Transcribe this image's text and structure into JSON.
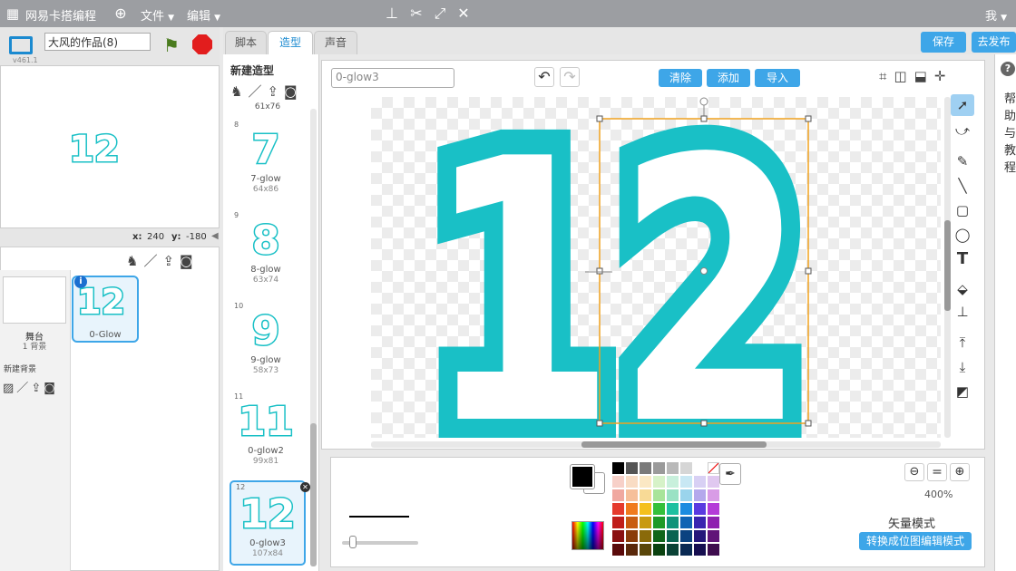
{
  "app": {
    "title": "网易卡搭编程",
    "menu_file": "文件",
    "menu_edit": "编辑",
    "user": "我"
  },
  "stage": {
    "project_name": "大风的作品(8)",
    "version": "v461.1",
    "display_text": "12",
    "x_label": "x:",
    "x_value": "240",
    "y_label": "y:",
    "y_value": "-180"
  },
  "sprites_panel": {
    "stage_label": "舞台",
    "backdrop_count": "1 背景",
    "new_backdrop": "新建背景",
    "sprite_name": "0-Glow",
    "sprite_text": "12"
  },
  "tabs": [
    {
      "label": "脚本"
    },
    {
      "label": "造型"
    },
    {
      "label": "声音"
    }
  ],
  "actions": {
    "save": "保存",
    "publish": "去发布"
  },
  "costumes": {
    "new_costume": "新建造型",
    "cut_top": "61x76",
    "items": [
      {
        "index": "8",
        "glyph": "7",
        "name": "7-glow",
        "size": "64x86"
      },
      {
        "index": "9",
        "glyph": "8",
        "name": "8-glow",
        "size": "63x74"
      },
      {
        "index": "10",
        "glyph": "9",
        "name": "9-glow",
        "size": "58x73"
      },
      {
        "index": "11",
        "glyph": "11",
        "name": "0-glow2",
        "size": "99x81"
      },
      {
        "index": "12",
        "glyph": "12",
        "name": "0-glow3",
        "size": "107x84"
      }
    ]
  },
  "editor": {
    "costume_name": "0-glow3",
    "clear": "清除",
    "add": "添加",
    "import": "导入",
    "canvas_text": "12",
    "zoom": "400%",
    "vector_mode": "矢量模式",
    "convert_bitmap": "转换成位图编辑模式"
  },
  "help": {
    "chars": [
      "帮",
      "助",
      "与",
      "教",
      "程"
    ]
  },
  "colors": {
    "accent": "#3ea6e8",
    "glow": "#19c0c6",
    "topbar": "#9c9ea2"
  }
}
